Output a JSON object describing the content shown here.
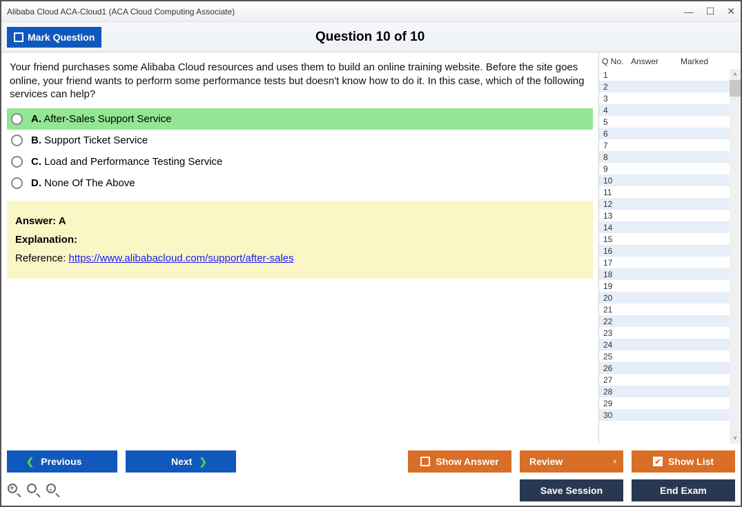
{
  "window": {
    "title": "Alibaba Cloud ACA-Cloud1 (ACA Cloud Computing Associate)"
  },
  "toolbar": {
    "mark_label": "Mark Question",
    "question_title": "Question 10 of 10"
  },
  "question": {
    "text": "Your friend purchases some Alibaba Cloud resources and uses them to build an online training website. Before the site goes online, your friend wants to perform some performance tests but doesn't know how to do it. In this case, which of the following services can help?",
    "options": [
      {
        "letter": "A.",
        "text": "After-Sales Support Service",
        "highlighted": true
      },
      {
        "letter": "B.",
        "text": "Support Ticket Service",
        "highlighted": false
      },
      {
        "letter": "C.",
        "text": "Load and Performance Testing Service",
        "highlighted": false
      },
      {
        "letter": "D.",
        "text": "None Of The Above",
        "highlighted": false
      }
    ]
  },
  "answer": {
    "line": "Answer: A",
    "explanation_label": "Explanation:",
    "ref_label": "Reference: ",
    "ref_url": "https://www.alibabacloud.com/support/after-sales"
  },
  "sidebar": {
    "headers": {
      "qno": "Q No.",
      "answer": "Answer",
      "marked": "Marked"
    },
    "rows": [
      1,
      2,
      3,
      4,
      5,
      6,
      7,
      8,
      9,
      10,
      11,
      12,
      13,
      14,
      15,
      16,
      17,
      18,
      19,
      20,
      21,
      22,
      23,
      24,
      25,
      26,
      27,
      28,
      29,
      30
    ]
  },
  "footer": {
    "previous": "Previous",
    "next": "Next",
    "show_answer": "Show Answer",
    "review": "Review",
    "show_list": "Show List",
    "save_session": "Save Session",
    "end_exam": "End Exam"
  }
}
